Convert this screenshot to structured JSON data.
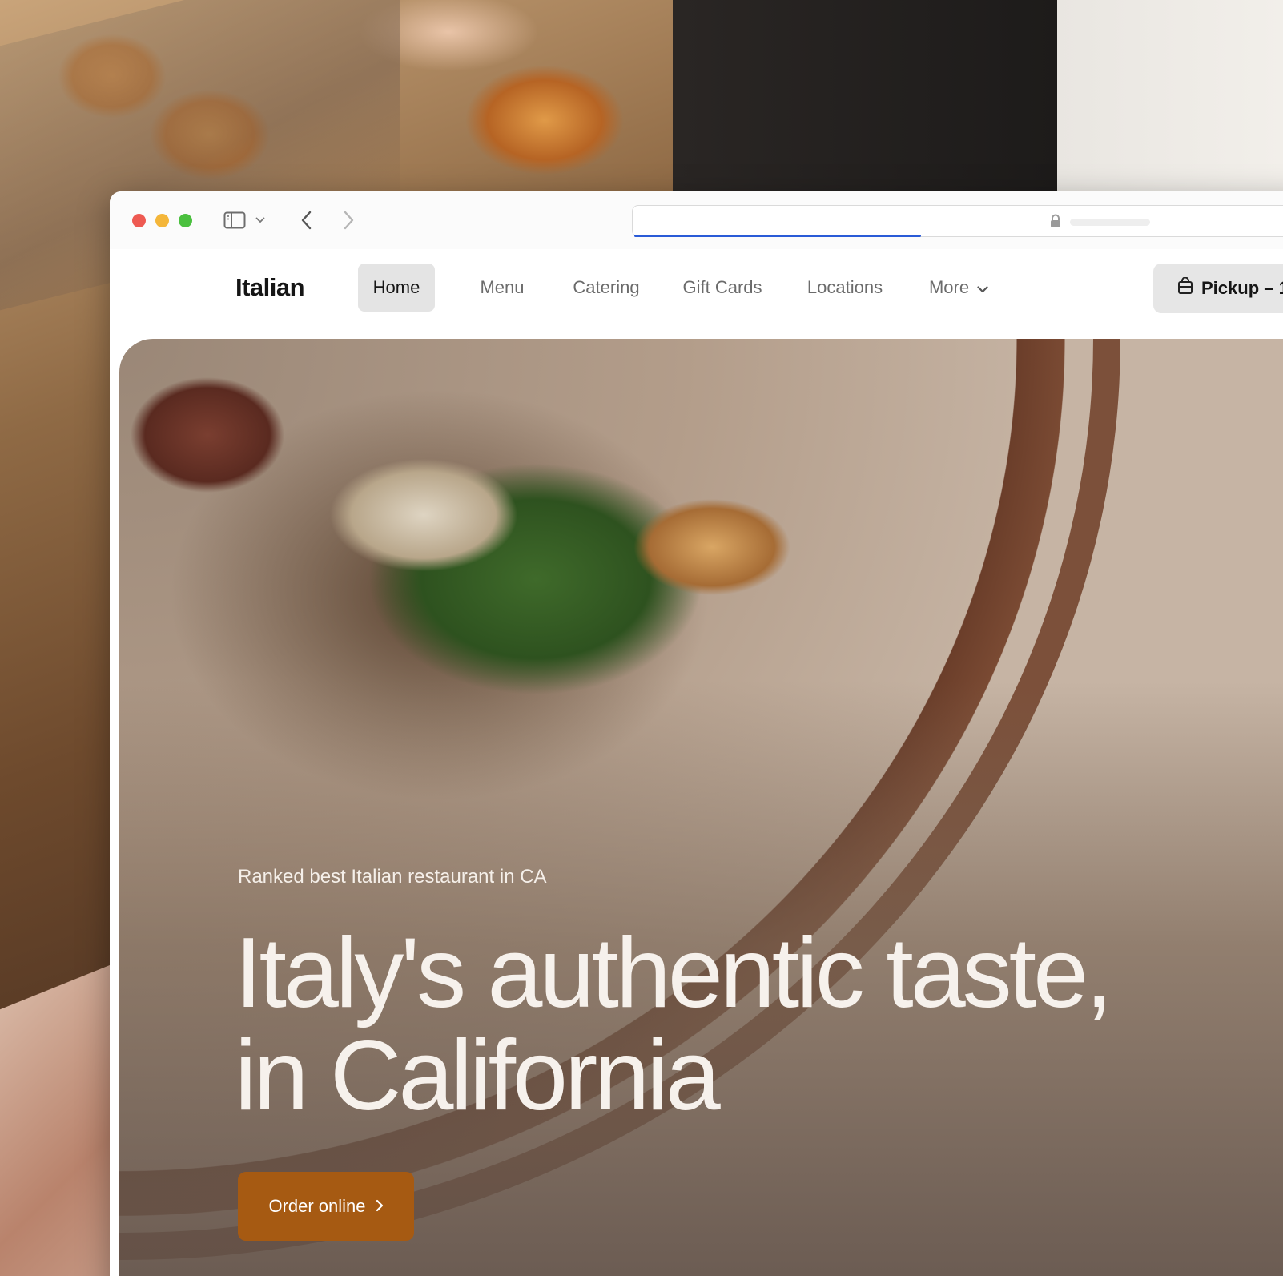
{
  "window": {
    "url_placeholder": ""
  },
  "nav": {
    "brand": "Italian",
    "items": [
      {
        "label": "Home",
        "active": true
      },
      {
        "label": "Menu"
      },
      {
        "label": "Catering"
      },
      {
        "label": "Gift Cards"
      },
      {
        "label": "Locations"
      },
      {
        "label": "More"
      }
    ],
    "pickup_label": "Pickup – 1"
  },
  "hero": {
    "kicker": "Ranked best Italian restaurant in CA",
    "title": "Italy's authentic taste, in California",
    "cta_label": "Order online"
  },
  "colors": {
    "accent": "#a65a12",
    "nav_active_bg": "#e4e4e4",
    "progress": "#2a5bd7"
  },
  "icons": [
    "sidebar-icon",
    "chevron-down-icon",
    "back-arrow-icon",
    "forward-arrow-icon",
    "lock-icon",
    "bag-icon",
    "chevron-right-icon"
  ]
}
